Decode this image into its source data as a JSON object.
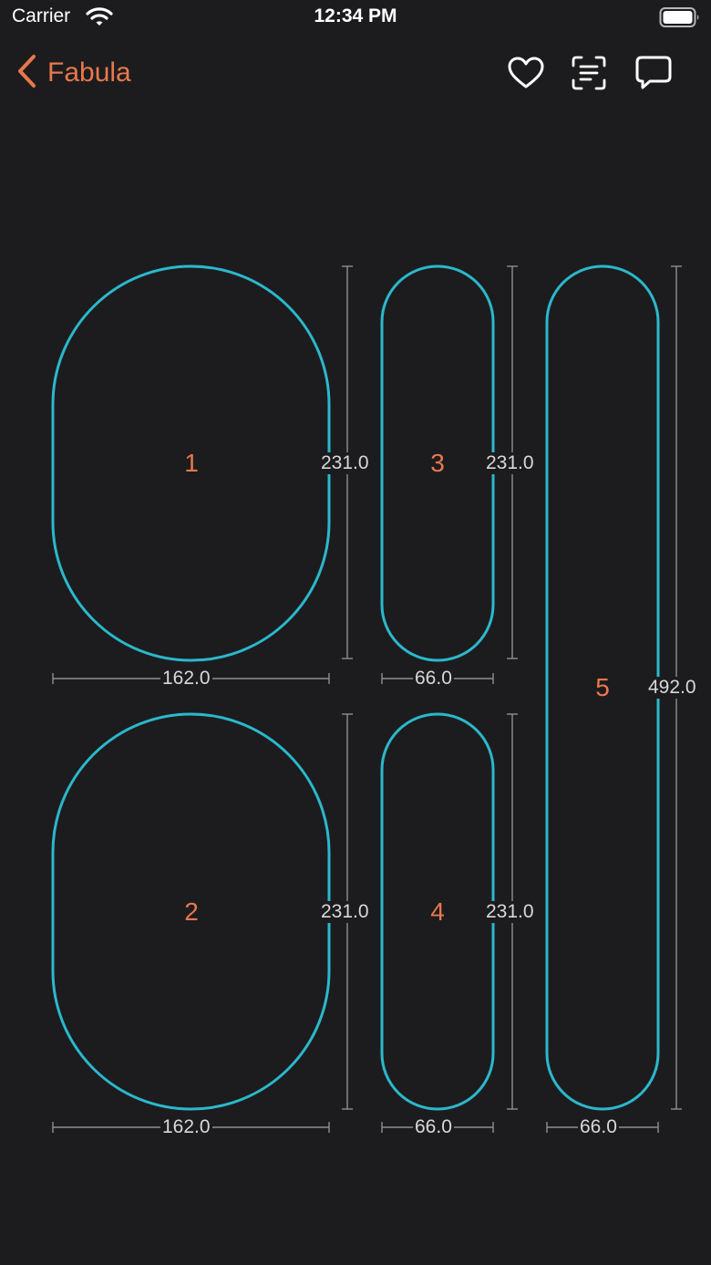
{
  "status_bar": {
    "carrier": "Carrier",
    "time": "12:34 PM"
  },
  "nav": {
    "back_label": "Fabula",
    "icons": [
      "heart-icon",
      "text-scan-icon",
      "comment-icon"
    ]
  },
  "colors": {
    "accent": "#e8784c",
    "shape_stroke": "#2bb8cc",
    "dimension_line": "#8e8e93",
    "background": "#1c1c1e"
  },
  "shapes": [
    {
      "number": "1",
      "width_label": "162.0",
      "height_label": "231.0"
    },
    {
      "number": "2",
      "width_label": "162.0",
      "height_label": "231.0"
    },
    {
      "number": "3",
      "width_label": "66.0",
      "height_label": "231.0"
    },
    {
      "number": "4",
      "width_label": "66.0",
      "height_label": "231.0"
    },
    {
      "number": "5",
      "width_label": "66.0",
      "height_label": "492.0"
    }
  ]
}
